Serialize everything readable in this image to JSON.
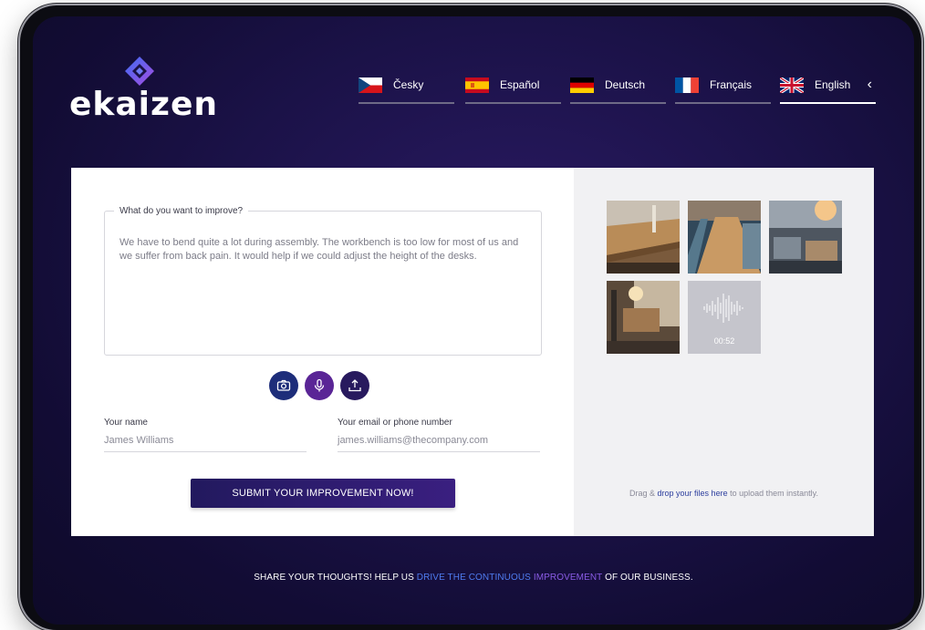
{
  "brand": {
    "name": "ekaizen",
    "accent": "#3f5cf0",
    "accent2": "#9b4de0"
  },
  "languages": [
    {
      "label": "Česky",
      "flag": "flag-czech-icon",
      "active": false
    },
    {
      "label": "Español",
      "flag": "flag-spain-icon",
      "active": false
    },
    {
      "label": "Deutsch",
      "flag": "flag-germany-icon",
      "active": false
    },
    {
      "label": "Français",
      "flag": "flag-france-icon",
      "active": false
    },
    {
      "label": "English",
      "flag": "flag-uk-icon",
      "active": true
    }
  ],
  "form": {
    "improve_label": "What do you want to improve?",
    "improve_text": "We have to bend quite a lot during assembly. The workbench is too low for most of us and we suffer from back pain. It would help if we could adjust the height of the desks.",
    "actions": [
      "camera-icon",
      "microphone-icon",
      "upload-icon"
    ],
    "name_label": "Your name",
    "name_value": "James Williams",
    "contact_label": "Your email or phone number",
    "contact_value": "james.williams@thecompany.com",
    "submit_label": "SUBMIT YOUR IMPROVEMENT NOW!"
  },
  "attachments": {
    "audio_duration": "00:52",
    "drop_prefix": "Drag & ",
    "drop_link": "drop your files here",
    "drop_suffix": " to upload them instantly."
  },
  "footer": {
    "part1": "SHARE YOUR THOUGHTS! HELP US ",
    "part2": "DRIVE THE CONTINUOUS ",
    "part3": "IMPROVEMENT",
    "part4": " OF OUR BUSINESS."
  }
}
